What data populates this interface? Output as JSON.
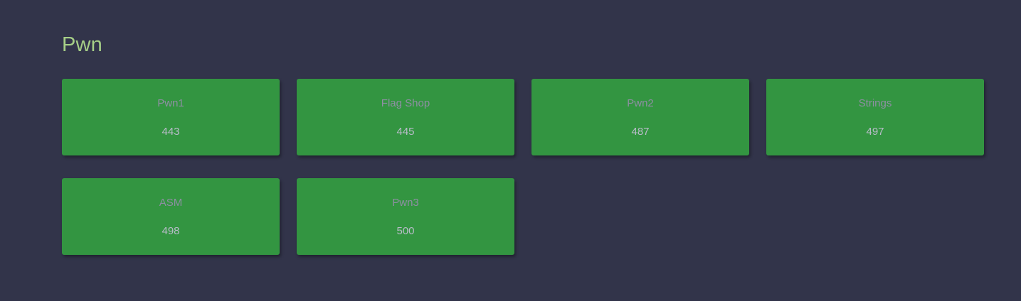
{
  "category": {
    "title": "Pwn",
    "challenges": [
      {
        "name": "Pwn1",
        "points": "443"
      },
      {
        "name": "Flag Shop",
        "points": "445"
      },
      {
        "name": "Pwn2",
        "points": "487"
      },
      {
        "name": "Strings",
        "points": "497"
      },
      {
        "name": "ASM",
        "points": "498"
      },
      {
        "name": "Pwn3",
        "points": "500"
      }
    ]
  },
  "colors": {
    "background": "#32344a",
    "card": "#339541",
    "title": "#a6cf87"
  }
}
